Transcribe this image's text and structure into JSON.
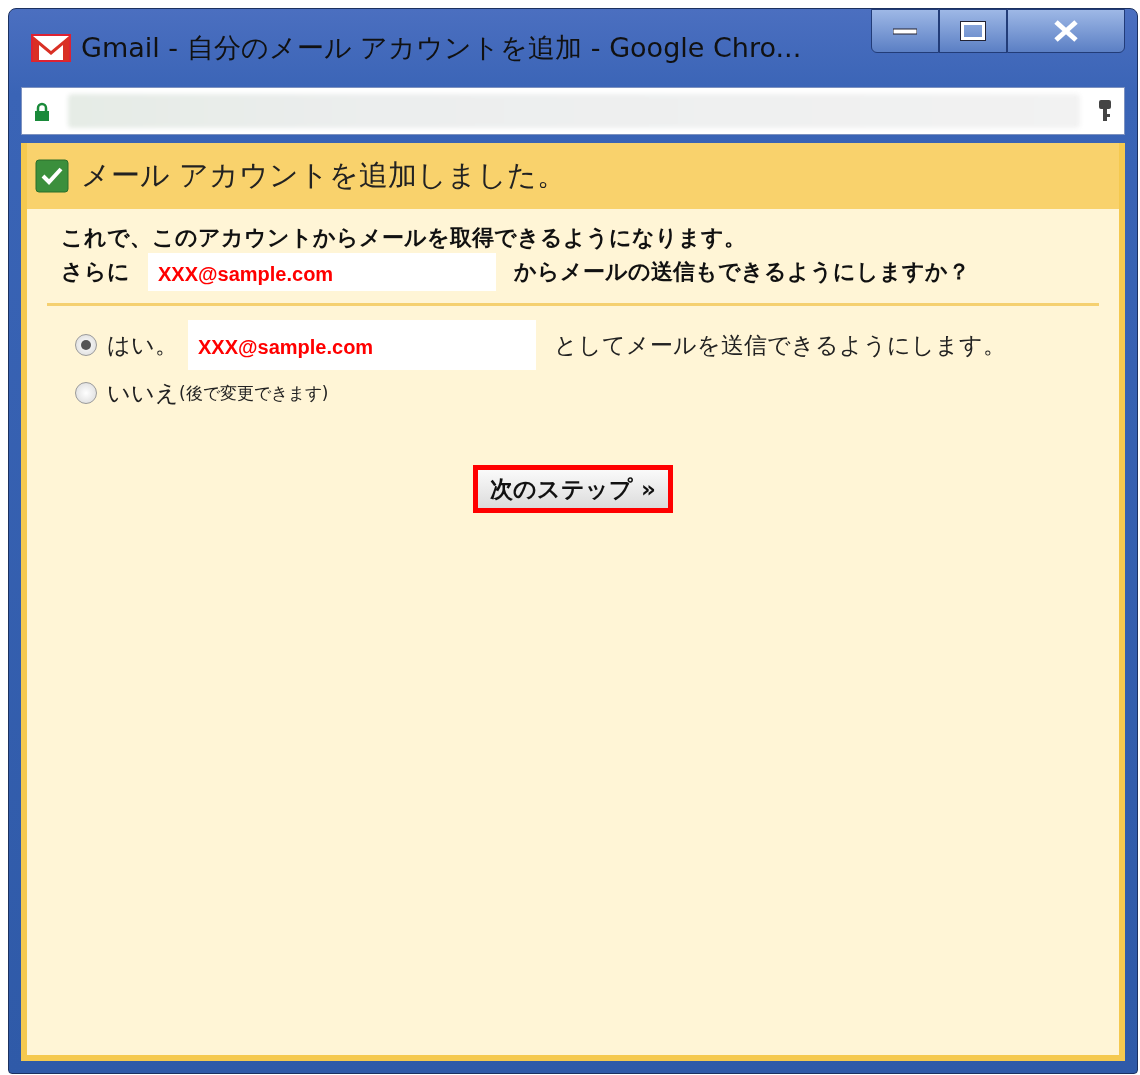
{
  "window": {
    "title": "Gmail - 自分のメール アカウントを追加 - Google Chro..."
  },
  "address_bar": {
    "secure": true
  },
  "banner": {
    "checked": true,
    "text": "メール アカウントを追加しました。"
  },
  "message": {
    "line_1": "これで、このアカウントからメールを取得できるようになります。",
    "line_2_before": "さらに",
    "email": "XXX@sample.com",
    "line_2_after": "からメールの送信もできるようにしますか？"
  },
  "options": [
    {
      "label": "はい。",
      "email": "XXX@sample.com",
      "after": "としてメールを送信できるようにします。",
      "selected": true
    },
    {
      "label": "いいえ",
      "note": "(後で変更できます)",
      "selected": false
    }
  ],
  "next_button": {
    "label": "次のステップ »"
  }
}
